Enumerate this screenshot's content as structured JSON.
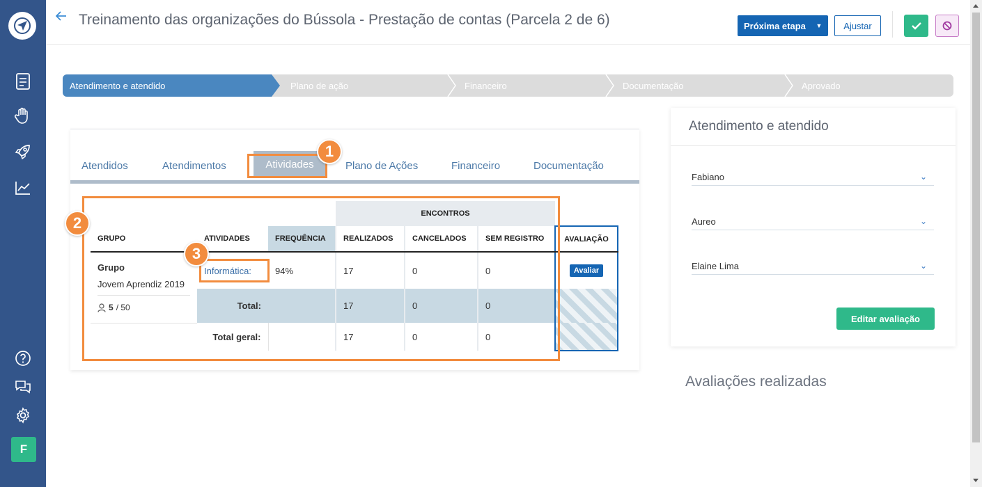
{
  "header": {
    "title": "Treinamento das organizações do Bússola - Prestação de contas (Parcela 2 de 6)",
    "next_step_label": "Próxima etapa",
    "adjust_label": "Ajustar"
  },
  "sidebar": {
    "avatar_initial": "F",
    "icons": [
      "document-icon",
      "hand-heart-icon",
      "rocket-icon",
      "chart-line-icon",
      "help-icon",
      "chat-icon",
      "gear-icon"
    ]
  },
  "stepper": {
    "steps": [
      "Atendimento e atendido",
      "Plano de ação",
      "Financeiro",
      "Documentação",
      "Aprovado"
    ],
    "active": 0
  },
  "tabs": {
    "items": [
      "Atendidos",
      "Atendimentos",
      "Atividades",
      "Plano de Ações",
      "Financeiro",
      "Documentação"
    ],
    "active": 2
  },
  "table": {
    "group_header": "ENCONTROS",
    "columns": [
      "GRUPO",
      "ATIVIDADES",
      "FREQUÊNCIA",
      "REALIZADOS",
      "CANCELADOS",
      "SEM REGISTRO",
      "AVALIAÇÃO"
    ],
    "group": {
      "label": "Grupo",
      "name": "Jovem Aprendiz 2019",
      "members_current": "5",
      "members_total": "/ 50"
    },
    "row": {
      "activity": "Informática:",
      "frequency": "94%",
      "realizados": "17",
      "cancelados": "0",
      "sem_registro": "0",
      "avaliar_label": "Avaliar"
    },
    "total": {
      "label": "Total:",
      "realizados": "17",
      "cancelados": "0",
      "sem_registro": "0"
    },
    "total_geral": {
      "label": "Total geral:",
      "realizados": "17",
      "cancelados": "0",
      "sem_registro": "0"
    }
  },
  "annotations": [
    "1",
    "2",
    "3"
  ],
  "right_panel": {
    "title": "Atendimento e atendido",
    "people": [
      "Fabiano",
      "Aureo",
      "Elaine Lima"
    ],
    "edit_button": "Editar avaliação"
  },
  "evaluations_title": "Avaliações realizadas",
  "colors": {
    "sidebar": "#33558a",
    "primary": "#1565b3",
    "success": "#2fb98a",
    "annotation": "#f28c3e",
    "tab_active": "#aebcca"
  }
}
